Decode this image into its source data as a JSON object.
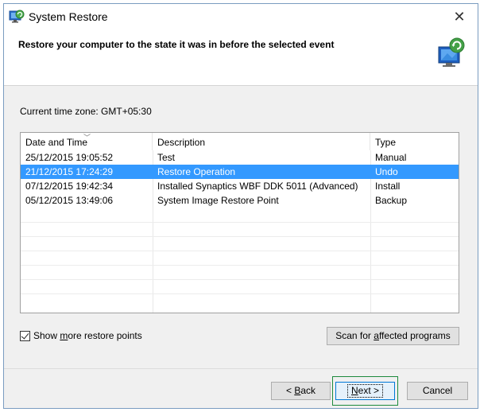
{
  "window": {
    "title": "System Restore"
  },
  "header": {
    "instruction": "Restore your computer to the state it was in before the selected event"
  },
  "timezone_label": "Current time zone: GMT+05:30",
  "table": {
    "columns": [
      "Date and Time",
      "Description",
      "Type"
    ],
    "rows": [
      {
        "date": "25/12/2015 19:05:52",
        "description": "Test",
        "type": "Manual",
        "selected": false
      },
      {
        "date": "21/12/2015 17:24:29",
        "description": "Restore Operation",
        "type": "Undo",
        "selected": true
      },
      {
        "date": "07/12/2015 19:42:34",
        "description": "Installed Synaptics WBF DDK 5011 (Advanced)",
        "type": "Install",
        "selected": false
      },
      {
        "date": "05/12/2015 13:49:06",
        "description": "System Image Restore Point",
        "type": "Backup",
        "selected": false
      }
    ]
  },
  "options": {
    "show_more_prefix": "Show ",
    "show_more_hotkey": "m",
    "show_more_suffix": "ore restore points",
    "show_more_checked": true
  },
  "buttons": {
    "scan_prefix": "Scan for ",
    "scan_hotkey": "a",
    "scan_suffix": "ffected programs",
    "back_prefix": "< ",
    "back_hotkey": "B",
    "back_suffix": "ack",
    "next_hotkey": "N",
    "next_suffix": "ext >",
    "cancel": "Cancel"
  },
  "colors": {
    "selection": "#3399ff",
    "focus_highlight": "#1d8a3c"
  },
  "icons": {
    "title": "system-restore-icon",
    "header": "restore-monitor-icon",
    "close": "close-icon"
  }
}
